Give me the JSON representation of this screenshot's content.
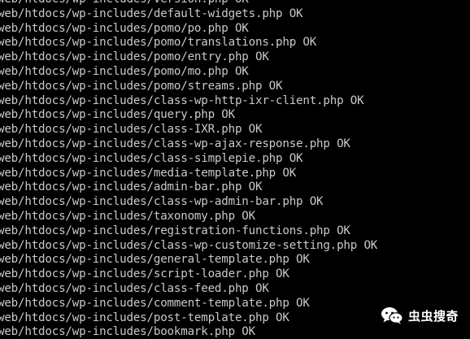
{
  "terminal": {
    "lines": [
      "web/htdocs/wp-includes/version.php OK",
      "web/htdocs/wp-includes/default-widgets.php OK",
      "web/htdocs/wp-includes/pomo/po.php OK",
      "web/htdocs/wp-includes/pomo/translations.php OK",
      "web/htdocs/wp-includes/pomo/entry.php OK",
      "web/htdocs/wp-includes/pomo/mo.php OK",
      "web/htdocs/wp-includes/pomo/streams.php OK",
      "web/htdocs/wp-includes/class-wp-http-ixr-client.php OK",
      "web/htdocs/wp-includes/query.php OK",
      "web/htdocs/wp-includes/class-IXR.php OK",
      "web/htdocs/wp-includes/class-wp-ajax-response.php OK",
      "web/htdocs/wp-includes/class-simplepie.php OK",
      "web/htdocs/wp-includes/media-template.php OK",
      "web/htdocs/wp-includes/admin-bar.php OK",
      "web/htdocs/wp-includes/class-wp-admin-bar.php OK",
      "web/htdocs/wp-includes/taxonomy.php OK",
      "web/htdocs/wp-includes/registration-functions.php OK",
      "web/htdocs/wp-includes/class-wp-customize-setting.php OK",
      "web/htdocs/wp-includes/general-template.php OK",
      "web/htdocs/wp-includes/script-loader.php OK",
      "web/htdocs/wp-includes/class-feed.php OK",
      "web/htdocs/wp-includes/comment-template.php OK",
      "web/htdocs/wp-includes/post-template.php OK",
      "web/htdocs/wp-includes/bookmark.php OK"
    ]
  },
  "watermark": {
    "text": "虫虫搜奇",
    "icon": "wechat-icon"
  },
  "colors": {
    "background": "#000000",
    "text": "#c9c9c9",
    "watermark": "#ffffff"
  }
}
